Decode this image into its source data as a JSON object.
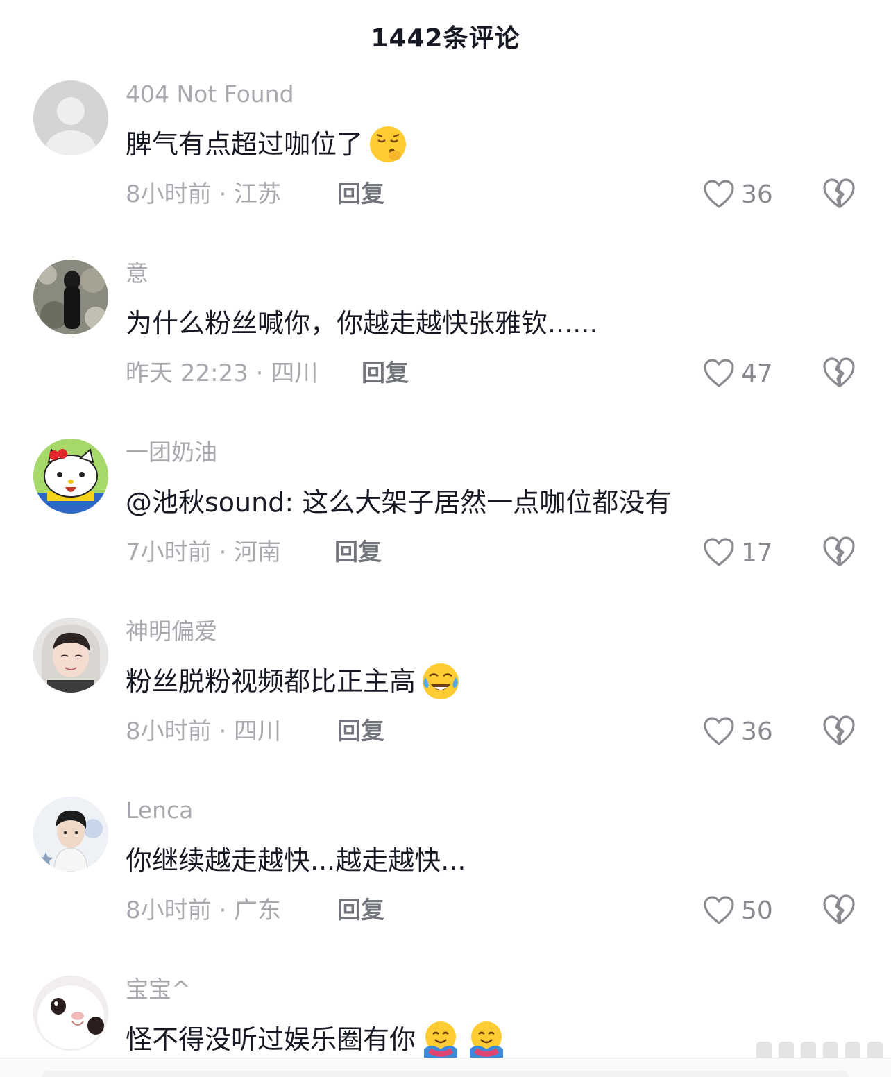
{
  "header": {
    "title": "1442条评论"
  },
  "reply_label": "回复",
  "comments": [
    {
      "username": "404 Not Found",
      "text": "脾气有点超过咖位了",
      "emoji": [
        "pensive-shush-face-emoji"
      ],
      "time_location": "8小时前 · 江苏",
      "likes": "36",
      "avatar": "default-avatar"
    },
    {
      "username": "意",
      "text": "为什么粉丝喊你，你越走越快张雅钦......",
      "emoji": [],
      "time_location": "昨天 22:23 · 四川",
      "likes": "47",
      "avatar": "photo-avatar"
    },
    {
      "username": "一团奶油",
      "text": "@池秋sound: 这么大架子居然一点咖位都没有",
      "emoji": [],
      "time_location": "7小时前 · 河南",
      "likes": "17",
      "avatar": "hello-kitty-avatar"
    },
    {
      "username": "神明偏爱",
      "text": "粉丝脱粉视频都比正主高",
      "emoji": [
        "loudly-crying-laughing-emoji"
      ],
      "time_location": "8小时前 · 四川",
      "likes": "36",
      "avatar": "portrait-avatar"
    },
    {
      "username": "Lenca",
      "text": "你继续越走越快...越走越快...",
      "emoji": [],
      "time_location": "8小时前 · 广东",
      "likes": "50",
      "avatar": "portrait-avatar-2"
    },
    {
      "username": "宝宝^",
      "text": "怪不得没听过娱乐圈有你",
      "emoji": [
        "hugging-face-emoji",
        "hugging-face-emoji"
      ],
      "time_location": "",
      "likes": "",
      "avatar": "cat-avatar"
    }
  ],
  "colors": {
    "text_primary": "#161823",
    "text_secondary": "#a8a9ae",
    "reply": "#73757d"
  }
}
